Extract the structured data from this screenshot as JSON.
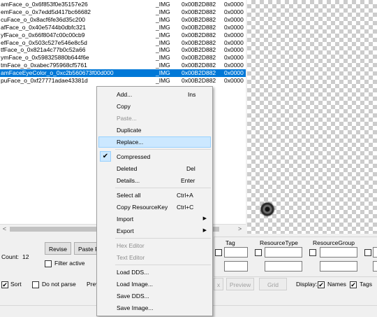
{
  "list": {
    "rows": [
      {
        "name": "amFace_o_0x6f853f0e35157e26",
        "tag": "_IMG",
        "type": "0x00B2D882",
        "group": "0x0000"
      },
      {
        "name": "emFace_o_0x7edd5d417bc66682",
        "tag": "_IMG",
        "type": "0x00B2D882",
        "group": "0x0000"
      },
      {
        "name": "cuFace_o_0x8acf6fe36d35c200",
        "tag": "_IMG",
        "type": "0x00B2D882",
        "group": "0x0000"
      },
      {
        "name": "afFace_o_0x40e5744b0dbfc321",
        "tag": "_IMG",
        "type": "0x00B2D882",
        "group": "0x0000"
      },
      {
        "name": "yfFace_o_0x66f8047c00c00cb9",
        "tag": "_IMG",
        "type": "0x00B2D882",
        "group": "0x0000"
      },
      {
        "name": "efFace_o_0x503c527e546e8c5d",
        "tag": "_IMG",
        "type": "0x00B2D882",
        "group": "0x0000"
      },
      {
        "name": "tfFace_o_0x821a4c77b0c52a66",
        "tag": "_IMG",
        "type": "0x00B2D882",
        "group": "0x0000"
      },
      {
        "name": "ymFace_o_0x598325880b644f6e",
        "tag": "_IMG",
        "type": "0x00B2D882",
        "group": "0x0000"
      },
      {
        "name": "tmFace_o_0xabec795968cf5761",
        "tag": "_IMG",
        "type": "0x00B2D882",
        "group": "0x0000"
      },
      {
        "name": "amFaceEyeColor_o_0xc2b560673f00d000",
        "tag": "_IMG",
        "type": "0x00B2D882",
        "group": "0x0000"
      },
      {
        "name": "puFace_o_0xf27771adae43381d",
        "tag": "_IMG",
        "type": "0x00B2D882",
        "group": "0x0000"
      }
    ],
    "selected_index": 9
  },
  "scrollbar": {
    "left_arrow": "<",
    "right_arrow": ">"
  },
  "bottom": {
    "count_label": "Count:",
    "count_value": "12",
    "revise_label": "Revise",
    "paste_label": "Paste R",
    "filter_active_label": "Filter active",
    "sort_label": "Sort",
    "sort_checked": true,
    "do_not_parse_label": "Do not parse",
    "prev_label": "Prev",
    "tag_label": "Tag",
    "resource_type_label": "ResourceType",
    "resource_group_label": "ResourceGroup",
    "x_button": "x",
    "preview_button": "Preview",
    "grid_button": "Grid",
    "display_label": "Display:",
    "names_label": "Names",
    "names_checked": true,
    "tags_label": "Tags",
    "tags_checked": true
  },
  "menu": {
    "add": {
      "label": "Add...",
      "shortcut": "Ins"
    },
    "copy": "Copy",
    "paste": "Paste...",
    "duplicate": "Duplicate",
    "replace": "Replace...",
    "compressed": "Compressed",
    "deleted": {
      "label": "Deleted",
      "shortcut": "Del"
    },
    "details": {
      "label": "Details...",
      "shortcut": "Enter"
    },
    "select_all": {
      "label": "Select all",
      "shortcut": "Ctrl+A"
    },
    "copy_resource_key": {
      "label": "Copy ResourceKey",
      "shortcut": "Ctrl+C"
    },
    "import": "Import",
    "export": "Export",
    "hex_editor": "Hex Editor",
    "text_editor": "Text Editor",
    "load_dds": "Load DDS...",
    "load_image": "Load Image...",
    "save_dds": "Save DDS...",
    "save_image": "Save Image...",
    "submenu_arrow": "▶",
    "check_mark": "✔"
  }
}
